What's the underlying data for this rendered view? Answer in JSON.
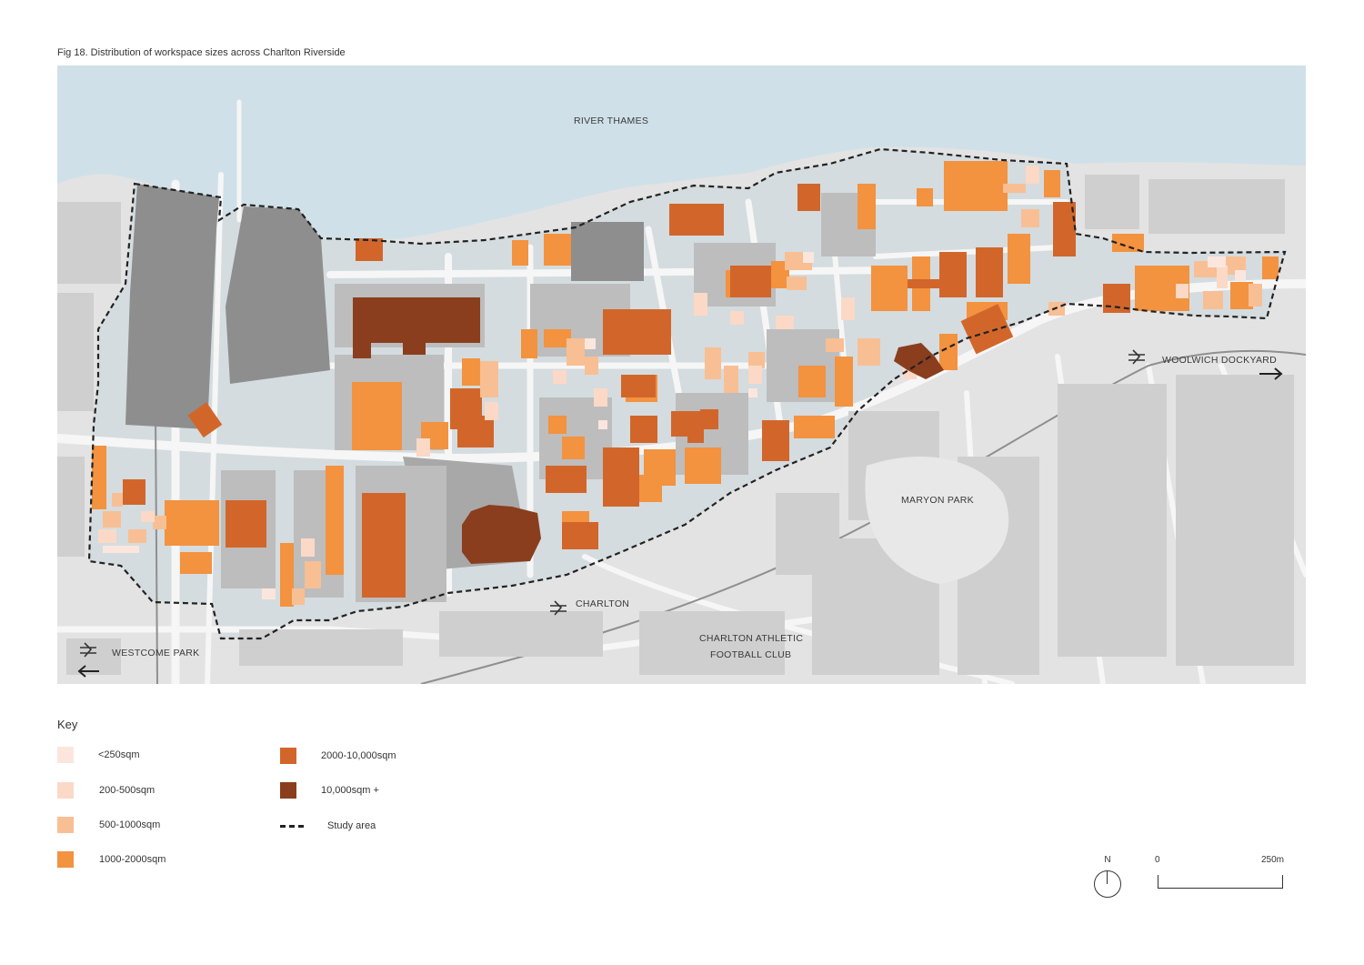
{
  "figure": {
    "title": "Fig 18. Distribution of workspace sizes across Charlton Riverside"
  },
  "map": {
    "labels": {
      "river": "RIVER THAMES",
      "woolwich": "WOOLWICH DOCKYARD",
      "maryon": "MARYON PARK",
      "charlton": "CHARLTON",
      "club_line1": "CHARLTON ATHLETIC",
      "club_line2": "FOOTBALL CLUB",
      "westcome": "WESTCOME PARK"
    },
    "colors": {
      "water": "#cfe0e8",
      "land": "#e3e3e3",
      "block": "#cfcfcf",
      "road": "#f6f6f6",
      "study_block": "#c5d3d8",
      "dark_grey": "#8e8e8e",
      "boundary": "#222222"
    },
    "icons": [
      "rail-station-icon",
      "arrow-right-icon",
      "arrow-left-icon"
    ]
  },
  "key": {
    "title": "Key",
    "items": [
      {
        "label": "<250sqm",
        "color": "#fbe6dd"
      },
      {
        "label": "200-500sqm",
        "color": "#fbd9c6"
      },
      {
        "label": "500-1000sqm",
        "color": "#f8bf94"
      },
      {
        "label": "1000-2000sqm",
        "color": "#f3923f"
      },
      {
        "label": "2000-10,000sqm",
        "color": "#d2662a"
      },
      {
        "label": "10,000sqm +",
        "color": "#8a3e1d"
      },
      {
        "label": "Study area",
        "color": "#222222"
      }
    ]
  },
  "north_arrow": {
    "label": "N"
  },
  "scale_bar": {
    "start": "0",
    "end": "250m"
  }
}
